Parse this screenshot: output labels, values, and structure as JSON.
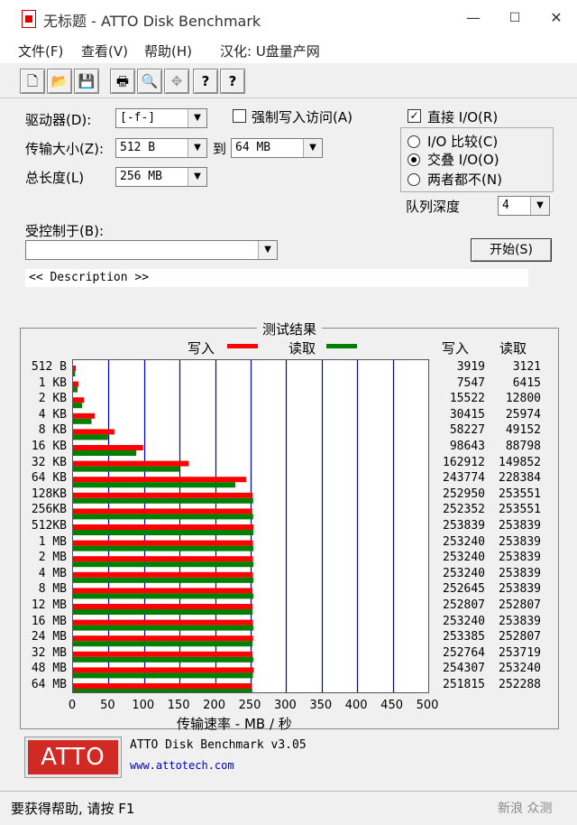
{
  "window": {
    "title": "无标题 - ATTO Disk Benchmark",
    "minimize_glyph": "—",
    "maximize_glyph": "☐",
    "close_glyph": "✕"
  },
  "menu": {
    "file": "文件(F)",
    "view": "查看(V)",
    "help": "帮助(H)",
    "localize": "汉化: U盘量产网"
  },
  "toolbar": {
    "icons": [
      "new-icon",
      "open-icon",
      "save-icon",
      "print-icon",
      "print-preview-icon",
      "move-icon",
      "help-icon",
      "context-help-icon"
    ],
    "glyphs": [
      "🗋",
      "📂",
      "💾",
      "🖶",
      "🔍",
      "✥",
      "?",
      "?"
    ]
  },
  "settings": {
    "drive_label": "驱动器(D):",
    "drive_value": "[-f-]",
    "force_write_label": "强制写入访问(A)",
    "force_write_checked": false,
    "transfer_label": "传输大小(Z):",
    "transfer_from": "512 B",
    "to_label": "到",
    "transfer_to": "64 MB",
    "total_length_label": "总长度(L)",
    "total_length": "256 MB",
    "direct_io_label": "直接 I/O(R)",
    "direct_io_checked": true,
    "checkmark": "✓",
    "io_compare_label": "I/O 比较(C)",
    "overlapped_io_label": "交叠 I/O(O)",
    "neither_label": "两者都不(N)",
    "queue_depth_label": "队列深度",
    "queue_depth_value": "4",
    "controlled_by_label": "受控制于(B):",
    "controlled_by_value": "",
    "start_button": "开始(S)",
    "description": "<< Description >>"
  },
  "results": {
    "title": "测试结果",
    "legend_write": "写入",
    "legend_read": "读取",
    "col_write": "写入",
    "col_read": "读取",
    "xlabel": "传输速率 - MB / 秒",
    "write_color": "#ff0000",
    "read_color": "#008000"
  },
  "chart_data": {
    "type": "bar",
    "orientation": "horizontal",
    "categories": [
      "512 B",
      "1 KB",
      "2 KB",
      "4 KB",
      "8 KB",
      "16 KB",
      "32 KB",
      "64 KB",
      "128KB",
      "256KB",
      "512KB",
      "1 MB",
      "2 MB",
      "4 MB",
      "8 MB",
      "12 MB",
      "16 MB",
      "24 MB",
      "32 MB",
      "48 MB",
      "64 MB"
    ],
    "series": [
      {
        "name": "写入",
        "values": [
          3919,
          7547,
          15522,
          30415,
          58227,
          98643,
          162912,
          243774,
          252950,
          252352,
          253839,
          253240,
          253240,
          253240,
          252645,
          252807,
          253240,
          253385,
          252764,
          254307,
          251815
        ]
      },
      {
        "name": "读取",
        "values": [
          3121,
          6415,
          12800,
          25974,
          49152,
          88798,
          149852,
          228384,
          253551,
          253551,
          253839,
          253839,
          253839,
          253839,
          253839,
          252807,
          253839,
          252807,
          253719,
          253240,
          252288
        ]
      }
    ],
    "xlim": [
      0,
      500
    ],
    "xticks": [
      "0",
      "50",
      "100",
      "150",
      "200",
      "250",
      "300",
      "350",
      "400",
      "450",
      "500"
    ],
    "xlabel": "传输速率 - MB / 秒",
    "value_units": "KB/s",
    "grid": true,
    "legend": "top"
  },
  "footer": {
    "logo_text": "ATTO",
    "product": "ATTO Disk Benchmark v3.05",
    "url": "www.attotech.com",
    "status": "要获得帮助, 请按 F1",
    "watermark": "新浪 众测"
  }
}
